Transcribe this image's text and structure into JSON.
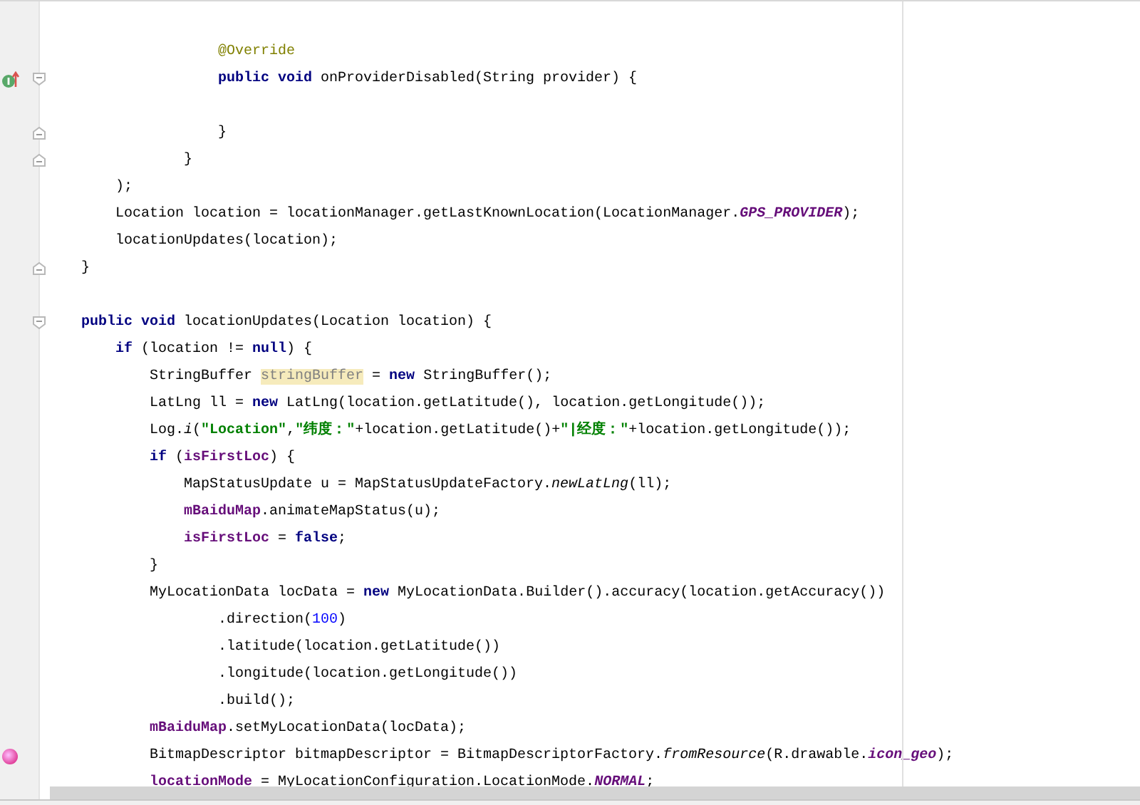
{
  "editor": {
    "lines": [
      {
        "kind": "group",
        "children": [
          {
            "kind": "group",
            "children": [
              {
                "kind": "group",
                "children": [
                  {
                    "kind": "group",
                    "children": [
                      {
                        "kind": "blank"
                      },
                      {
                        "kind": "line",
                        "segments": [
                          {
                            "text": "@Override",
                            "kind": "annotation"
                          }
                        ]
                      },
                      {
                        "kind": "line",
                        "implements_marker": true,
                        "fold_start": true,
                        "segments": [
                          {
                            "text": "public void",
                            "kind": "keyword"
                          },
                          {
                            "text": " onProviderDisabled(String provider) {",
                            "kind": "plain"
                          }
                        ]
                      },
                      {
                        "kind": "blank"
                      },
                      {
                        "kind": "line",
                        "fold_end": true,
                        "segments": [
                          {
                            "text": "}",
                            "kind": "plain"
                          }
                        ]
                      }
                    ]
                  },
                  {
                    "kind": "line",
                    "fold_end": true,
                    "segments": [
                      {
                        "text": "}",
                        "kind": "plain"
                      }
                    ]
                  }
                ]
              }
            ]
          },
          {
            "kind": "line",
            "segments": [
              {
                "text": ");",
                "kind": "plain"
              }
            ]
          },
          {
            "kind": "line",
            "segments": [
              {
                "text": "Location location = locationManager.getLastKnownLocation(LocationManager.",
                "kind": "plain"
              },
              {
                "text": "GPS_PROVIDER",
                "kind": "static"
              },
              {
                "text": ");",
                "kind": "plain"
              }
            ]
          },
          {
            "kind": "line",
            "segments": [
              {
                "text": "locationUpdates(location);",
                "kind": "plain"
              }
            ]
          }
        ]
      },
      {
        "kind": "line",
        "fold_end": true,
        "segments": [
          {
            "text": "}",
            "kind": "plain"
          }
        ]
      },
      {
        "kind": "blank"
      },
      {
        "kind": "line",
        "fold_start": true,
        "segments": [
          {
            "text": "public void",
            "kind": "keyword"
          },
          {
            "text": " locationUpdates(Location location) {",
            "kind": "plain"
          }
        ],
        "children": [
          {
            "kind": "line",
            "segments": [
              {
                "text": "if",
                "kind": "keyword"
              },
              {
                "text": " (location != ",
                "kind": "plain"
              },
              {
                "text": "null",
                "kind": "keyword"
              },
              {
                "text": ") {",
                "kind": "plain"
              }
            ],
            "children": [
              {
                "kind": "line",
                "segments": [
                  {
                    "text": "StringBuffer ",
                    "kind": "plain"
                  },
                  {
                    "text": "stringBuffer",
                    "kind": "unused"
                  },
                  {
                    "text": " = ",
                    "kind": "plain"
                  },
                  {
                    "text": "new",
                    "kind": "keyword"
                  },
                  {
                    "text": " StringBuffer();",
                    "kind": "plain"
                  }
                ]
              },
              {
                "kind": "line",
                "segments": [
                  {
                    "text": "LatLng ll = ",
                    "kind": "plain"
                  },
                  {
                    "text": "new",
                    "kind": "keyword"
                  },
                  {
                    "text": " LatLng(location.getLatitude(), location.getLongitude());",
                    "kind": "plain"
                  }
                ]
              },
              {
                "kind": "line",
                "segments": [
                  {
                    "text": "Log.",
                    "kind": "plain"
                  },
                  {
                    "text": "i",
                    "kind": "italic"
                  },
                  {
                    "text": "(",
                    "kind": "plain"
                  },
                  {
                    "text": "\"Location\"",
                    "kind": "string"
                  },
                  {
                    "text": ",",
                    "kind": "plain"
                  },
                  {
                    "text": "\"纬度：\"",
                    "kind": "string"
                  },
                  {
                    "text": "+location.getLatitude()+",
                    "kind": "plain"
                  },
                  {
                    "text": "\"|经度：\"",
                    "kind": "string"
                  },
                  {
                    "text": "+location.getLongitude());",
                    "kind": "plain"
                  }
                ]
              },
              {
                "kind": "line",
                "segments": [
                  {
                    "text": "if",
                    "kind": "keyword"
                  },
                  {
                    "text": " (",
                    "kind": "plain"
                  },
                  {
                    "text": "isFirstLoc",
                    "kind": "field"
                  },
                  {
                    "text": ") {",
                    "kind": "plain"
                  }
                ],
                "children": [
                  {
                    "kind": "line",
                    "segments": [
                      {
                        "text": "MapStatusUpdate u = MapStatusUpdateFactory.",
                        "kind": "plain"
                      },
                      {
                        "text": "newLatLng",
                        "kind": "italic"
                      },
                      {
                        "text": "(ll);",
                        "kind": "plain"
                      }
                    ]
                  },
                  {
                    "kind": "line",
                    "segments": [
                      {
                        "text": "mBaiduMap",
                        "kind": "field"
                      },
                      {
                        "text": ".animateMapStatus(u);",
                        "kind": "plain"
                      }
                    ]
                  },
                  {
                    "kind": "line",
                    "segments": [
                      {
                        "text": "isFirstLoc",
                        "kind": "field"
                      },
                      {
                        "text": " = ",
                        "kind": "plain"
                      },
                      {
                        "text": "false",
                        "kind": "keyword"
                      },
                      {
                        "text": ";",
                        "kind": "plain"
                      }
                    ]
                  }
                ]
              },
              {
                "kind": "line",
                "segments": [
                  {
                    "text": "}",
                    "kind": "plain"
                  }
                ]
              },
              {
                "kind": "line",
                "segments": [
                  {
                    "text": "MyLocationData locData = ",
                    "kind": "plain"
                  },
                  {
                    "text": "new",
                    "kind": "keyword"
                  },
                  {
                    "text": " MyLocationData.Builder().accuracy(location.getAccuracy())",
                    "kind": "plain"
                  }
                ],
                "children": [
                  {
                    "kind": "group",
                    "children": [
                      {
                        "kind": "line",
                        "segments": [
                          {
                            "text": ".direction(",
                            "kind": "plain"
                          },
                          {
                            "text": "100",
                            "kind": "number"
                          },
                          {
                            "text": ")",
                            "kind": "plain"
                          }
                        ]
                      },
                      {
                        "kind": "line",
                        "segments": [
                          {
                            "text": ".latitude(location.getLatitude())",
                            "kind": "plain"
                          }
                        ]
                      },
                      {
                        "kind": "line",
                        "segments": [
                          {
                            "text": ".longitude(location.getLongitude())",
                            "kind": "plain"
                          }
                        ]
                      },
                      {
                        "kind": "line",
                        "segments": [
                          {
                            "text": ".build();",
                            "kind": "plain"
                          }
                        ]
                      }
                    ]
                  }
                ]
              },
              {
                "kind": "line",
                "segments": [
                  {
                    "text": "mBaiduMap",
                    "kind": "field"
                  },
                  {
                    "text": ".setMyLocationData(locData);",
                    "kind": "plain"
                  }
                ]
              },
              {
                "kind": "line",
                "breakpoint": true,
                "segments": [
                  {
                    "text": "BitmapDescriptor bitmapDescriptor = BitmapDescriptorFactory.",
                    "kind": "plain"
                  },
                  {
                    "text": "fromResource",
                    "kind": "italic"
                  },
                  {
                    "text": "(R.drawable.",
                    "kind": "plain"
                  },
                  {
                    "text": "icon_geo",
                    "kind": "static"
                  },
                  {
                    "text": ");",
                    "kind": "plain"
                  }
                ]
              },
              {
                "kind": "line",
                "segments": [
                  {
                    "text": "locationMode",
                    "kind": "field"
                  },
                  {
                    "text": " = MyLocationConfiguration.LocationMode.",
                    "kind": "plain"
                  },
                  {
                    "text": "NORMAL",
                    "kind": "static"
                  },
                  {
                    "text": ";",
                    "kind": "plain"
                  }
                ]
              }
            ]
          }
        ]
      }
    ]
  }
}
